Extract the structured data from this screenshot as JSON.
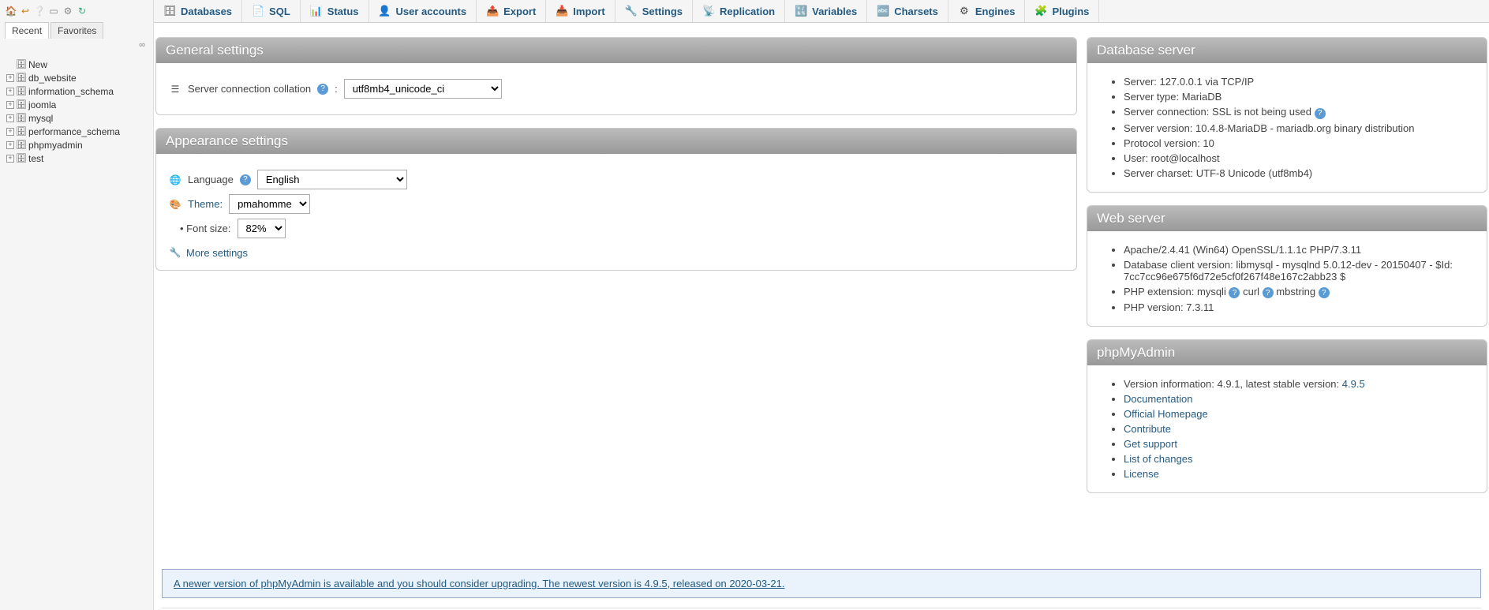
{
  "sidebar": {
    "tabs": {
      "recent": "Recent",
      "favorites": "Favorites"
    },
    "link_icon": "∞",
    "new_label": "New",
    "databases": [
      "db_website",
      "information_schema",
      "joomla",
      "mysql",
      "performance_schema",
      "phpmyadmin",
      "test"
    ]
  },
  "topmenu": [
    {
      "label": "Databases"
    },
    {
      "label": "SQL"
    },
    {
      "label": "Status"
    },
    {
      "label": "User accounts"
    },
    {
      "label": "Export"
    },
    {
      "label": "Import"
    },
    {
      "label": "Settings"
    },
    {
      "label": "Replication"
    },
    {
      "label": "Variables"
    },
    {
      "label": "Charsets"
    },
    {
      "label": "Engines"
    },
    {
      "label": "Plugins"
    }
  ],
  "general": {
    "title": "General settings",
    "collation_label": "Server connection collation",
    "collation_value": "utf8mb4_unicode_ci"
  },
  "appearance": {
    "title": "Appearance settings",
    "language_label": "Language",
    "language_value": "English",
    "theme_label": "Theme:",
    "theme_value": "pmahomme",
    "fontsize_label": "Font size:",
    "fontsize_value": "82%",
    "more_settings": "More settings"
  },
  "dbserver": {
    "title": "Database server",
    "items": [
      "Server: 127.0.0.1 via TCP/IP",
      "Server type: MariaDB",
      "Server connection: SSL is not being used",
      "Server version: 10.4.8-MariaDB - mariadb.org binary distribution",
      "Protocol version: 10",
      "User: root@localhost",
      "Server charset: UTF-8 Unicode (utf8mb4)"
    ]
  },
  "webserver": {
    "title": "Web server",
    "apache": "Apache/2.4.41 (Win64) OpenSSL/1.1.1c PHP/7.3.11",
    "dbclient": "Database client version: libmysql - mysqlnd 5.0.12-dev - 20150407 - $Id: 7cc7cc96e675f6d72e5cf0f267f48e167c2abb23 $",
    "phpext_label": "PHP extension:",
    "phpext_1": "mysqli",
    "phpext_2": "curl",
    "phpext_3": "mbstring",
    "phpver": "PHP version: 7.3.11"
  },
  "pma": {
    "title": "phpMyAdmin",
    "version_label": "Version information: 4.9.1, latest stable version: ",
    "version_link": "4.9.5",
    "links": [
      "Documentation",
      "Official Homepage",
      "Contribute",
      "Get support",
      "List of changes",
      "License"
    ]
  },
  "notice": {
    "text": "A newer version of phpMyAdmin is available and you should consider upgrading. The newest version is 4.9.5, released on 2020-03-21."
  }
}
